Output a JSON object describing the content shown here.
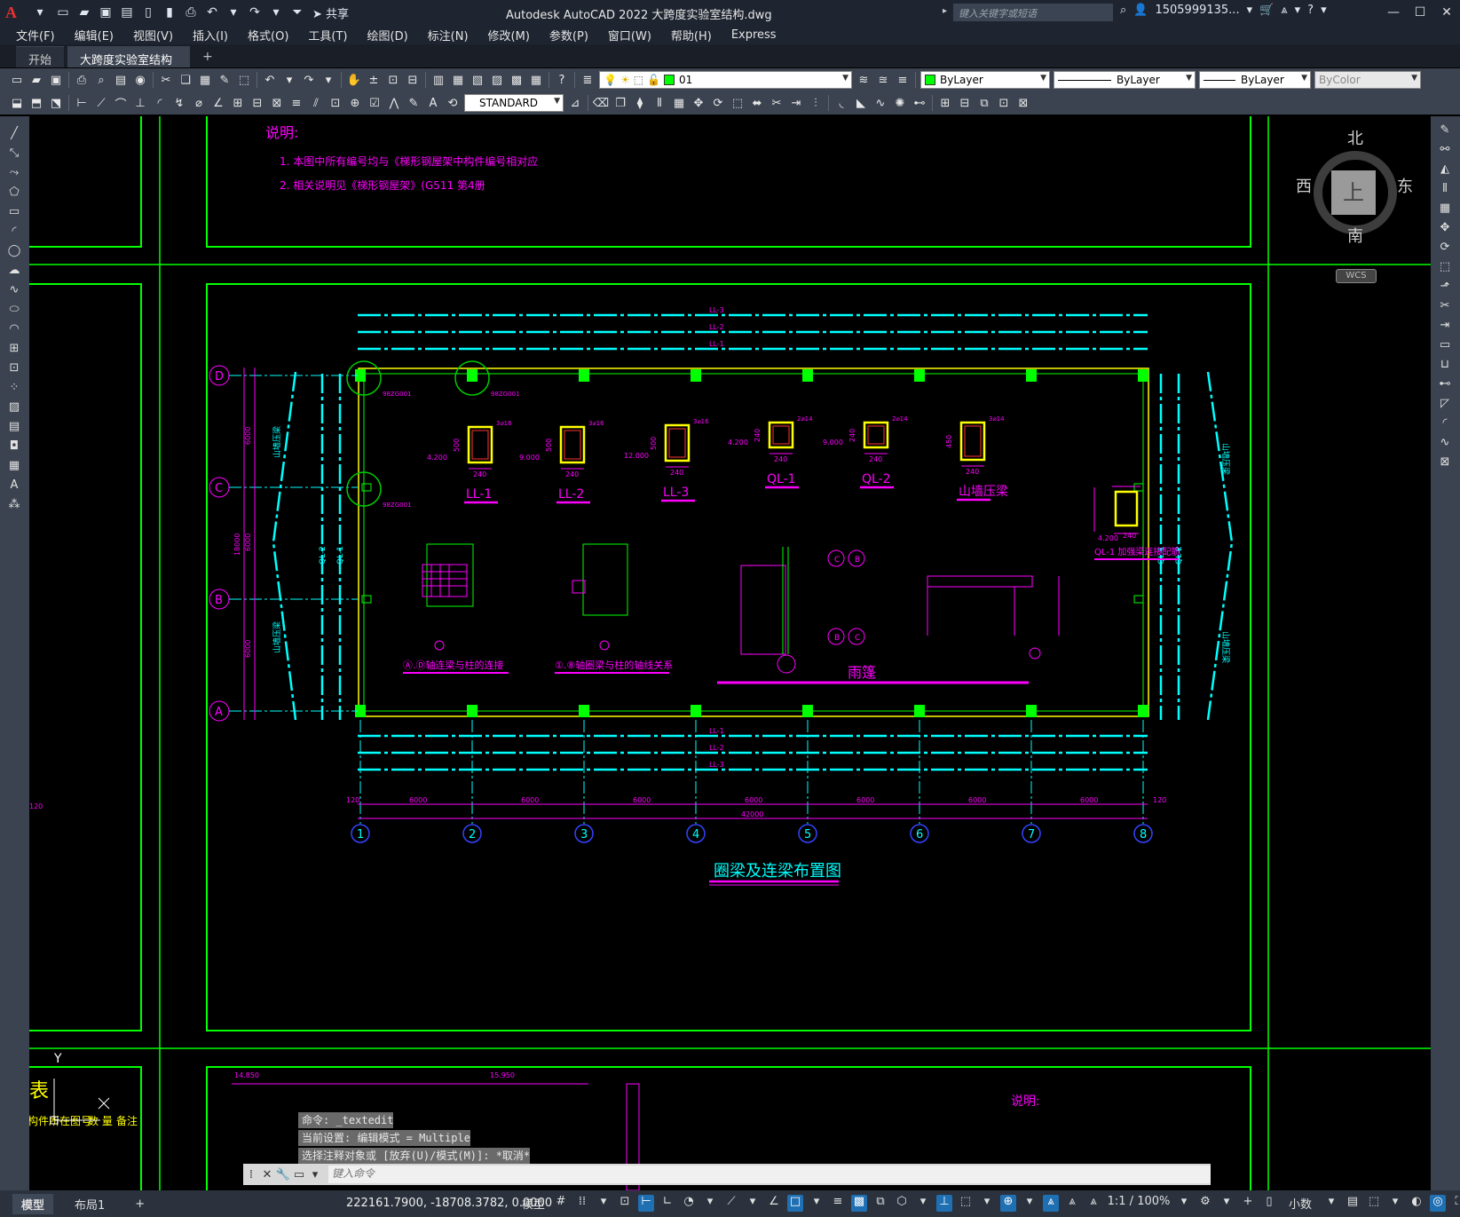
{
  "app": {
    "logo": "A",
    "title": "Autodesk AutoCAD 2022    大跨度实验室结构.dwg",
    "search_placeholder": "键入关键字或短语",
    "user": "1505999135...",
    "share": "共享"
  },
  "menu": [
    "文件(F)",
    "编辑(E)",
    "视图(V)",
    "插入(I)",
    "格式(O)",
    "工具(T)",
    "绘图(D)",
    "标注(N)",
    "修改(M)",
    "参数(P)",
    "窗口(W)",
    "帮助(H)",
    "Express"
  ],
  "tabs": {
    "start": "开始",
    "active": "大跨度实验室结构*",
    "close": "✕",
    "add": "+"
  },
  "toolbar1": {
    "layer": "01",
    "color": "ByLayer",
    "linetype": "ByLayer",
    "lineweight": "ByLayer",
    "plotstyle": "ByColor"
  },
  "toolbar2": {
    "text_style": "STANDARD"
  },
  "viewcube": {
    "north": "北",
    "south": "南",
    "east": "东",
    "west": "西",
    "top": "上",
    "wcs": "WCS"
  },
  "drawing": {
    "notes_title": "说明:",
    "note1": "1. 本图中所有编号均与《梯形钢屋架中构件编号相对应",
    "note2": "2. 相关说明见《梯形钢屋架》(G511 第4册",
    "plan_title": "圈梁及连梁布置图",
    "grid_rows": [
      "D",
      "C",
      "B",
      "A"
    ],
    "grid_cols": [
      "1",
      "2",
      "3",
      "4",
      "5",
      "6",
      "7",
      "8"
    ],
    "beam_lines_top": [
      "LL-3",
      "LL-2",
      "LL-1"
    ],
    "beam_lines_bottom": [
      "LL-1",
      "LL-2",
      "LL-3"
    ],
    "sections": [
      "LL-1",
      "LL-2",
      "LL-3",
      "QL-1",
      "QL-2",
      "山墙压梁"
    ],
    "section_dim": "240",
    "section_heights": [
      "500",
      "500",
      "500",
      "240",
      "240",
      "450"
    ],
    "section_bars": [
      "3⌀16",
      "3⌀16",
      "3⌀16",
      "2⌀14",
      "2⌀14",
      "3⌀14"
    ],
    "section_elevs": [
      "4.200",
      "9.000",
      "12.000",
      "4.200",
      "9.000",
      ""
    ],
    "ql1_detail": "QL-1 加强梁连接配筋",
    "ql1_elev": "4.200",
    "detail1": "Ⓐ.Ⓓ轴连梁与柱的连接",
    "detail2": "①.⑧轴圈梁与柱的轴线关系",
    "canopy": "雨篷",
    "bay_dims": [
      "6000",
      "6000",
      "6000",
      "6000",
      "6000",
      "6000",
      "6000"
    ],
    "total_dim": "42000",
    "edge_dim": "120",
    "row_dims": [
      "6000",
      "6000",
      "6000"
    ],
    "row_total": "18000",
    "gable_label": "山墙压梁",
    "ql_labels": [
      "QL-2",
      "QL-1"
    ],
    "col_tags": [
      "98ZG001",
      "98ZG001",
      "98ZG001"
    ],
    "lower_notes_title": "说明:",
    "lower_elev1": "14.850",
    "lower_elev2": "15.950",
    "table_title": "表",
    "table_headers": [
      "构件所在图号",
      "数 量",
      "备注"
    ],
    "ucs_y": "Y"
  },
  "command": {
    "history": [
      "命令: _textedit",
      "当前设置: 编辑模式 = Multiple",
      "选择注释对象或 [放弃(U)/模式(M)]: *取消*"
    ],
    "placeholder": "键入命令"
  },
  "status": {
    "layouts": [
      "模型",
      "布局1"
    ],
    "coords": "222161.7900, -18708.3782, 0.0000",
    "space": "模型",
    "scale": "1:1 / 100%",
    "units": "小数"
  },
  "colors": {
    "frame": "#00ff00",
    "axis": "#00ffff",
    "dim": "#ff00ff",
    "col": "#00ff00",
    "grid_bubble": "#3344ff"
  }
}
